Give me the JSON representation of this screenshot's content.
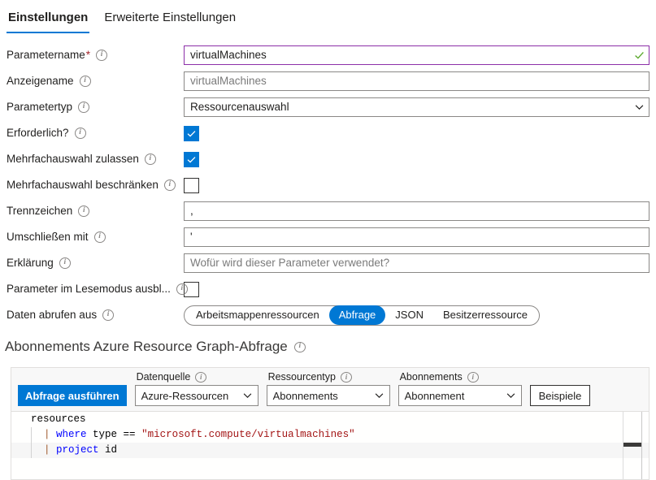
{
  "tabs": [
    {
      "label": "Einstellungen",
      "active": true
    },
    {
      "label": "Erweiterte Einstellungen",
      "active": false
    }
  ],
  "form": {
    "parameter_name": {
      "label": "Parametername",
      "required_marker": "*",
      "value": "virtualMachines",
      "valid_icon": "checkmark-icon",
      "info_icon": "info-icon"
    },
    "display_name": {
      "label": "Anzeigename",
      "value": "",
      "placeholder": "virtualMachines"
    },
    "parameter_type": {
      "label": "Parametertyp",
      "value": "Ressourcenauswahl",
      "chevron": "chevron-down-icon"
    },
    "required": {
      "label": "Erforderlich?",
      "checked": true
    },
    "allow_multi_select": {
      "label": "Mehrfachauswahl zulassen",
      "checked": true
    },
    "limit_multi_select": {
      "label": "Mehrfachauswahl beschränken",
      "checked": false
    },
    "delimiter": {
      "label": "Trennzeichen",
      "value": ","
    },
    "quote_with": {
      "label": "Umschließen mit",
      "value": "'"
    },
    "explanation": {
      "label": "Erklärung",
      "value": "",
      "placeholder": "Wofür wird dieser Parameter verwendet?"
    },
    "hide_param_read_mode": {
      "label": "Parameter im Lesemodus ausbl...",
      "checked": false
    },
    "get_data_from": {
      "label": "Daten abrufen aus",
      "options": [
        {
          "label": "Arbeitsmappenressourcen",
          "active": false
        },
        {
          "label": "Abfrage",
          "active": true
        },
        {
          "label": "JSON",
          "active": false
        },
        {
          "label": "Besitzerressource",
          "active": false
        }
      ]
    }
  },
  "section": {
    "title": "Abonnements Azure Resource Graph-Abfrage",
    "info_icon": "info-icon"
  },
  "query_toolbar": {
    "run_button": "Abfrage ausführen",
    "data_source": {
      "label": "Datenquelle",
      "value": "Azure-Ressourcen"
    },
    "resource_type": {
      "label": "Ressourcentyp",
      "value": "Abonnements"
    },
    "subscriptions": {
      "label": "Abonnements",
      "value": "Abonnement"
    },
    "samples_button": "Beispiele"
  },
  "editor": {
    "lines": [
      {
        "indent": 0,
        "segments": [
          {
            "t": "resources",
            "c": "tok-plain"
          }
        ]
      },
      {
        "indent": 1,
        "segments": [
          {
            "t": "| ",
            "c": "tok-pipe"
          },
          {
            "t": "where",
            "c": "tok-kw"
          },
          {
            "t": " type ",
            "c": "tok-plain"
          },
          {
            "t": "==",
            "c": "tok-op"
          },
          {
            "t": " ",
            "c": "tok-plain"
          },
          {
            "t": "\"microsoft.compute/virtualmachines\"",
            "c": "tok-str"
          }
        ]
      },
      {
        "indent": 1,
        "current": true,
        "segments": [
          {
            "t": "| ",
            "c": "tok-pipe"
          },
          {
            "t": "project",
            "c": "tok-kw"
          },
          {
            "t": " id",
            "c": "tok-plain"
          }
        ]
      }
    ]
  },
  "colors": {
    "accent": "#0078d4",
    "focus_border": "#8c2fa8",
    "valid_green": "#5aa82c",
    "required_red": "#a4262c",
    "keyword_blue": "#0000ff",
    "string_red": "#a31515",
    "pipe_brown": "#a05a2c"
  }
}
